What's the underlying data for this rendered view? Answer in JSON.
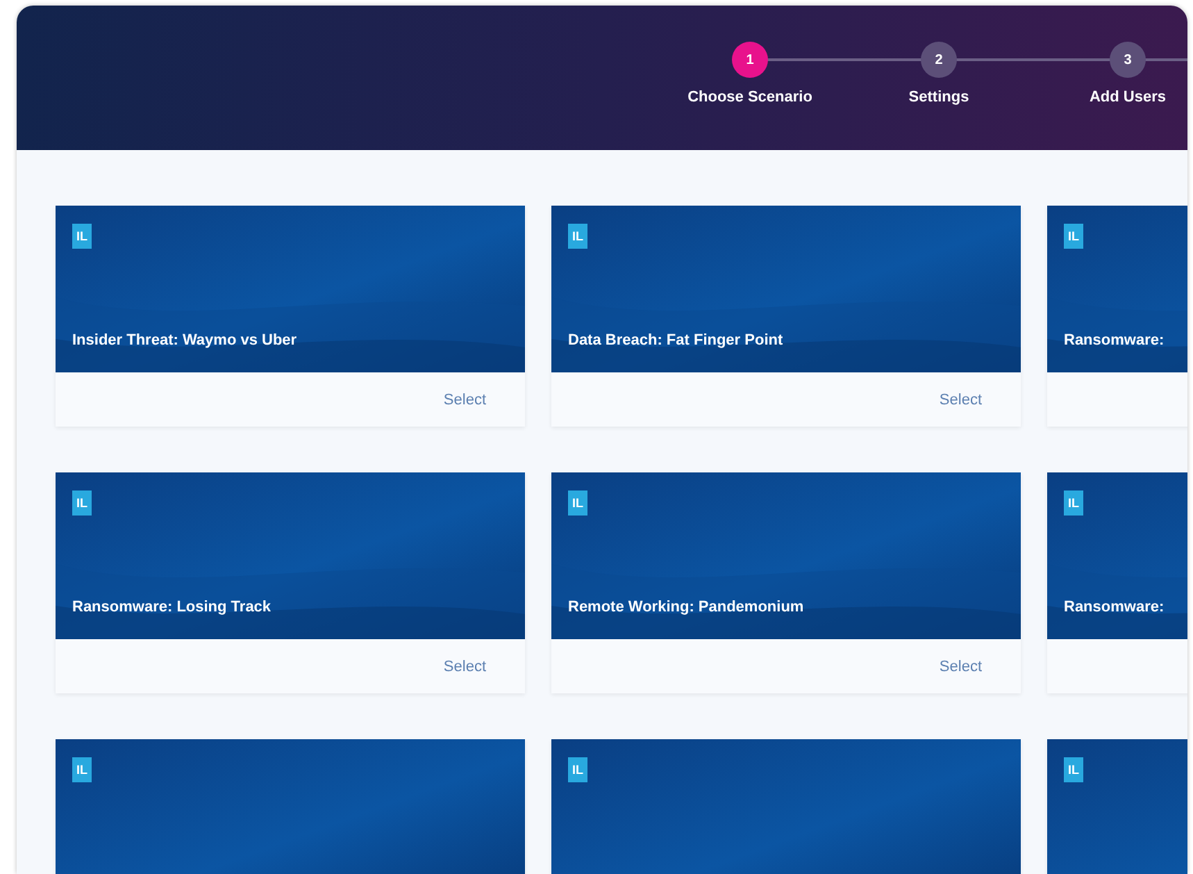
{
  "stepper": [
    {
      "number": "1",
      "label": "Choose Scenario",
      "selected": true
    },
    {
      "number": "2",
      "label": "Settings",
      "selected": false
    },
    {
      "number": "3",
      "label": "Add Users",
      "selected": false
    }
  ],
  "cards": [
    {
      "logo": "IL",
      "title": "Insider Threat: Waymo vs Uber",
      "action": "Select"
    },
    {
      "logo": "IL",
      "title": "Data Breach: Fat Finger Point",
      "action": "Select"
    },
    {
      "logo": "IL",
      "title": "Ransomware:"
    },
    {
      "logo": "IL",
      "title": "Ransomware: Losing Track",
      "action": "Select"
    },
    {
      "logo": "IL",
      "title": "Remote Working: Pandemonium",
      "action": "Select"
    },
    {
      "logo": "IL",
      "title": "Ransomware:"
    },
    {
      "logo": "IL"
    },
    {
      "logo": "IL"
    },
    {
      "logo": "IL"
    }
  ]
}
